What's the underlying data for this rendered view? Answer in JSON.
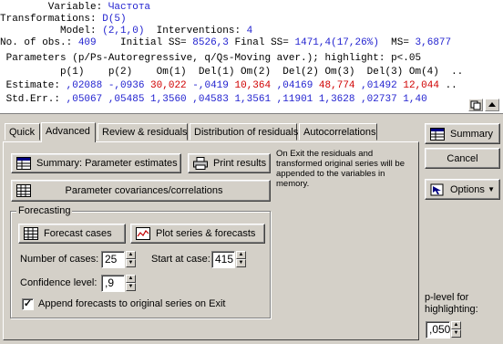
{
  "results": {
    "line1_label": "        Variable: ",
    "line1_value": "Частота",
    "line2_label": "Transformations: ",
    "line2_value": "D(5)",
    "line3_label": "          Model: ",
    "line3_value": "(2,1,0)",
    "line3_mid": "  Interventions: ",
    "line3_value2": "4",
    "line4_a": "No. of obs.: ",
    "line4_obs": "409",
    "line4_b": "    Initial SS= ",
    "line4_iss": "8526,3",
    "line4_c": " Final SS= ",
    "line4_fss": "1471,4(17,26%)",
    "line4_d": "  MS= ",
    "line4_ms": "3,6877",
    "line5": " Parameters (p/Ps-Autoregressive, q/Qs-Moving aver.); highlight: p<.05",
    "line6": "          p(1)    p(2)    Om(1)  Del(1) Om(2)  Del(2) Om(3)  Del(3) Om(4)  ..",
    "line7_label": " Estimate: ",
    "estimates": [
      {
        "v": ",02088",
        "c": "blue"
      },
      {
        "v": " -,0936",
        "c": "blue"
      },
      {
        "v": " 30,022",
        "c": "red"
      },
      {
        "v": " -,0419",
        "c": "blue"
      },
      {
        "v": " 10,364",
        "c": "red"
      },
      {
        "v": " ,04169",
        "c": "blue"
      },
      {
        "v": " 48,774",
        "c": "red"
      },
      {
        "v": " ,01492",
        "c": "blue"
      },
      {
        "v": " 12,044",
        "c": "red"
      },
      {
        "v": " ..",
        "c": "black"
      }
    ],
    "line8_label": " Std.Err.: ",
    "stderrs": ",05067 ,05485 1,3560 ,04583 1,3561 ,11901 1,3628 ,02737 1,40"
  },
  "tabs": [
    "Quick",
    "Advanced",
    "Review & residuals",
    "Distribution of residuals",
    "Autocorrelations"
  ],
  "active_tab": "Advanced",
  "buttons": {
    "summary_param": "Summary:  Parameter estimates",
    "print_results": "Print results",
    "param_cov": "Parameter covariances/correlations",
    "forecast_cases": "Forecast cases",
    "plot_series": "Plot series & forecasts",
    "summary": "Summary",
    "cancel": "Cancel",
    "options": "Options"
  },
  "note": "On Exit the residuals and transformed original series will be appended to the variables in memory.",
  "forecasting": {
    "title": "Forecasting",
    "num_cases_label": "Number of cases:",
    "num_cases": "25",
    "start_label": "Start at case:",
    "start_case": "415",
    "confidence_label": "Confidence level:",
    "confidence": ",9",
    "append_label": "Append forecasts to original series on Exit",
    "append_checked": "✓"
  },
  "plevel": {
    "label": "p-level for highlighting:",
    "value": ",050"
  }
}
